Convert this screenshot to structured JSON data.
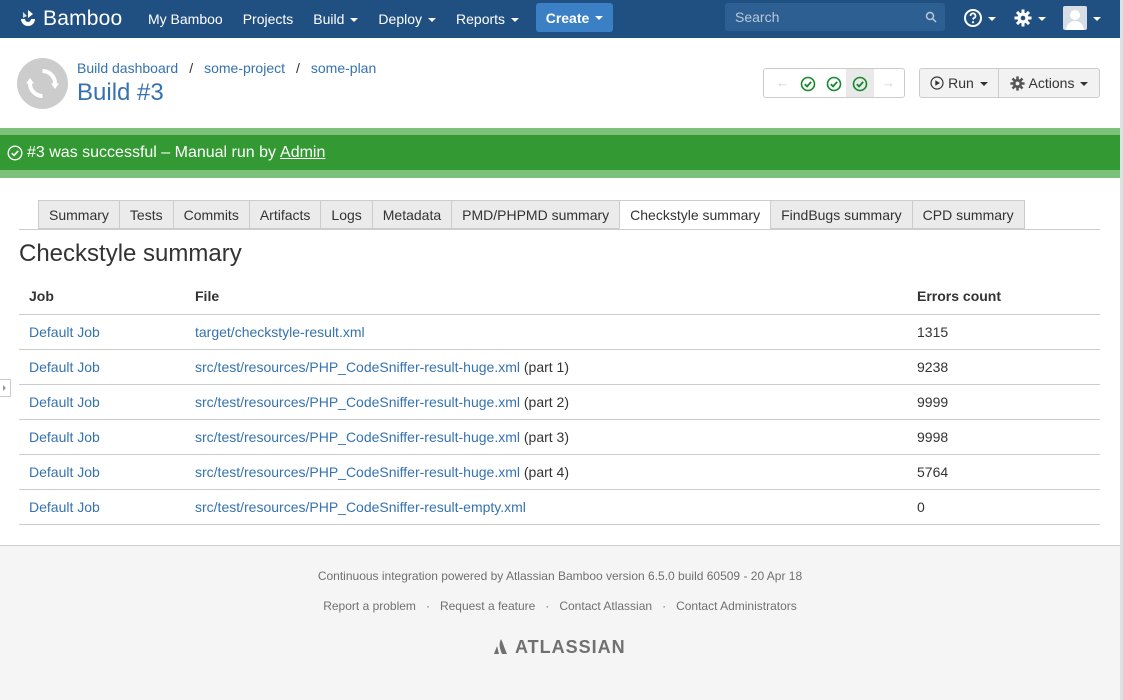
{
  "header": {
    "logo_text": "Bamboo",
    "nav": [
      "My Bamboo",
      "Projects",
      "Build",
      "Deploy",
      "Reports"
    ],
    "nav_has_dropdown": [
      false,
      false,
      true,
      true,
      true
    ],
    "create_label": "Create",
    "search_placeholder": "Search",
    "help_icon": "help-icon",
    "settings_icon": "gear-icon",
    "avatar_icon": "user-avatar-icon"
  },
  "breadcrumb": [
    "Build dashboard",
    "some-project",
    "some-plan"
  ],
  "build_title": "Build #3",
  "build_nav": {
    "results": [
      "success",
      "success",
      "success"
    ],
    "selected_index": 2
  },
  "buttons": {
    "run": "Run",
    "actions": "Actions"
  },
  "status": {
    "text": "#3 was successful – Manual run by",
    "user": "Admin",
    "color": "#339933"
  },
  "tabs": [
    "Summary",
    "Tests",
    "Commits",
    "Artifacts",
    "Logs",
    "Metadata",
    "PMD/PHPMD summary",
    "Checkstyle summary",
    "FindBugs summary",
    "CPD summary"
  ],
  "active_tab": "Checkstyle summary",
  "section_title": "Checkstyle summary",
  "table": {
    "headers": [
      "Job",
      "File",
      "Errors count"
    ],
    "rows": [
      {
        "job": "Default Job",
        "file": "target/checkstyle-result.xml",
        "part": "",
        "errors": "1315"
      },
      {
        "job": "Default Job",
        "file": "src/test/resources/PHP_CodeSniffer-result-huge.xml",
        "part": "(part 1)",
        "errors": "9238"
      },
      {
        "job": "Default Job",
        "file": "src/test/resources/PHP_CodeSniffer-result-huge.xml",
        "part": "(part 2)",
        "errors": "9999"
      },
      {
        "job": "Default Job",
        "file": "src/test/resources/PHP_CodeSniffer-result-huge.xml",
        "part": "(part 3)",
        "errors": "9998"
      },
      {
        "job": "Default Job",
        "file": "src/test/resources/PHP_CodeSniffer-result-huge.xml",
        "part": "(part 4)",
        "errors": "5764"
      },
      {
        "job": "Default Job",
        "file": "src/test/resources/PHP_CodeSniffer-result-empty.xml",
        "part": "",
        "errors": "0"
      }
    ]
  },
  "footer": {
    "powered": "Continuous integration powered by Atlassian Bamboo version 6.5.0 build 60509 - 20 Apr 18",
    "links": [
      "Report a problem",
      "Request a feature",
      "Contact Atlassian",
      "Contact Administrators"
    ],
    "brand": "ATLASSIAN"
  },
  "colors": {
    "header": "#205081",
    "link": "#3572b0",
    "success": "#339933",
    "success_band": "#7bc17a"
  }
}
